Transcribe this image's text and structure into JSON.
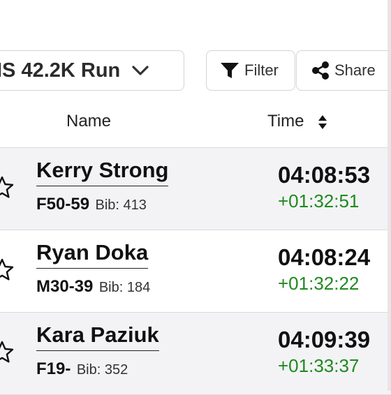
{
  "toolbar": {
    "race_label": "IS 42.2K Run",
    "filter_label": "Filter",
    "share_label": "Share"
  },
  "table": {
    "columns": {
      "name": "Name",
      "time": "Time"
    },
    "rows": [
      {
        "name": "Kerry Strong",
        "category": "F50-59",
        "bib": "Bib: 413",
        "time": "04:08:53",
        "gap": "+01:32:51"
      },
      {
        "name": "Ryan Doka",
        "category": "M30-39",
        "bib": "Bib: 184",
        "time": "04:08:24",
        "gap": "+01:32:22"
      },
      {
        "name": "Kara Paziuk",
        "category": "F19-",
        "bib": "Bib: 352",
        "time": "04:09:39",
        "gap": "+01:33:37"
      }
    ]
  },
  "colors": {
    "accent_green": "#1f8a1f",
    "row_shade": "#f3f3f5",
    "border": "#dcdcdc"
  },
  "icons": [
    "chevron-down-icon",
    "filter-icon",
    "share-icon",
    "sort-icon",
    "star-icon"
  ]
}
